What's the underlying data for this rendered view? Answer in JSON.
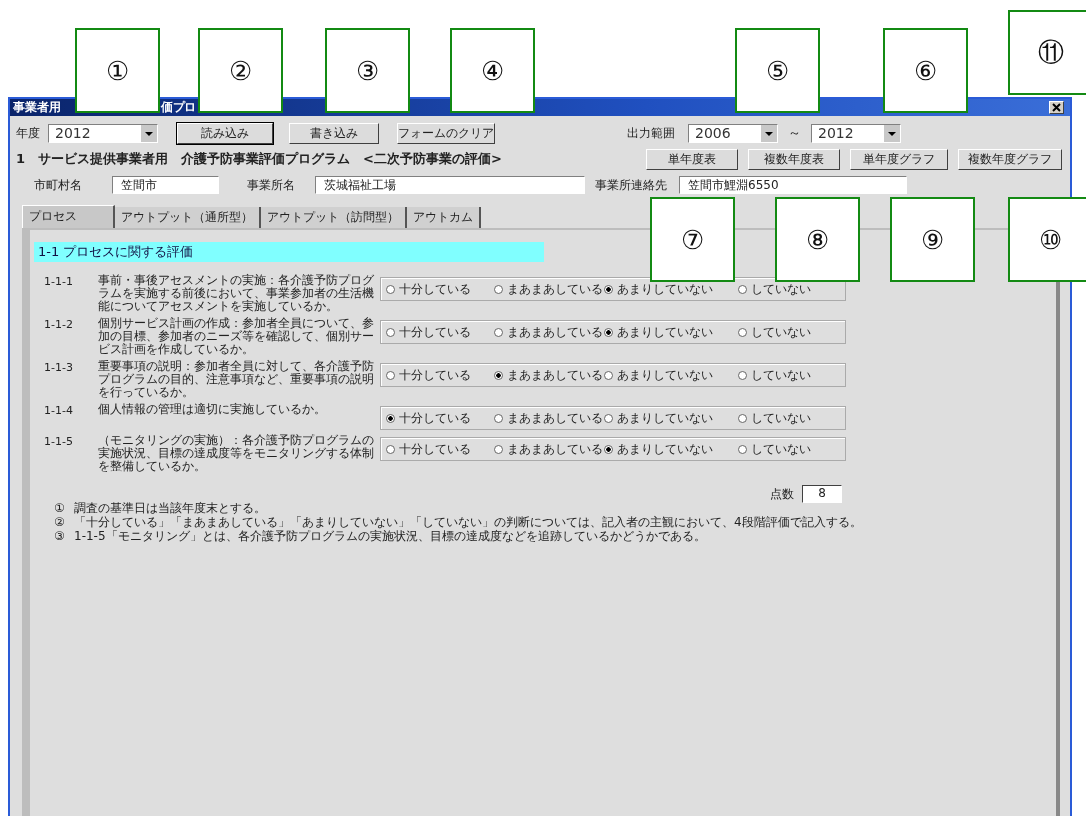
{
  "callouts": [
    {
      "label": "①"
    },
    {
      "label": "②"
    },
    {
      "label": "③"
    },
    {
      "label": "④"
    },
    {
      "label": "⑤"
    },
    {
      "label": "⑥"
    },
    {
      "label": "⑪"
    },
    {
      "label": "⑦"
    },
    {
      "label": "⑧"
    },
    {
      "label": "⑨"
    },
    {
      "label": "⑩"
    }
  ],
  "window": {
    "title_parts": [
      "事業者用",
      "価プロ"
    ]
  },
  "toolbar": {
    "year_label": "年度",
    "year": "2012",
    "buttons": [
      {
        "label": "読み込み",
        "default": true
      },
      {
        "label": "書き込み",
        "default": false
      },
      {
        "label": "フォームのクリア",
        "default": false
      }
    ],
    "range_label": "出力範囲",
    "range_from": "2006",
    "range_sep": "～",
    "range_to": "2012"
  },
  "heading": "1　サービス提供事業者用　介護予防事業評価プログラム　<二次予防事業の評価>",
  "report_buttons": [
    "単年度表",
    "複数年度表",
    "単年度グラフ",
    "複数年度グラフ"
  ],
  "fields": [
    {
      "label": "市町村名",
      "value": "笠間市"
    },
    {
      "label": "事業所名",
      "value": "茨城福祉工場"
    },
    {
      "label": "事業所連絡先",
      "value": "笠間市鯉淵6550"
    }
  ],
  "tabs": [
    {
      "label": "プロセス",
      "selected": true
    },
    {
      "label": "アウトプット（通所型）",
      "selected": false
    },
    {
      "label": "アウトプット（訪問型）",
      "selected": false
    },
    {
      "label": "アウトカム",
      "selected": false
    }
  ],
  "section": "1-1 プロセスに関する評価",
  "items": [
    {
      "number": "1-1-1",
      "text": "事前・事後アセスメントの実施：各介護予防プログラムを実施する前後において、事業参加者の生活機能についてアセスメントを実施しているか。",
      "options": [
        {
          "label": "十分している",
          "selected": false
        },
        {
          "label": "まあまあしている",
          "selected": false
        },
        {
          "label": "あまりしていない",
          "selected": true
        },
        {
          "label": "していない",
          "selected": false
        }
      ]
    },
    {
      "number": "1-1-2",
      "text": "個別サービス計画の作成：参加者全員について、参加の目標、参加者のニーズ等を確認して、個別サービス計画を作成しているか。",
      "options": [
        {
          "label": "十分している",
          "selected": false
        },
        {
          "label": "まあまあしている",
          "selected": false
        },
        {
          "label": "あまりしていない",
          "selected": true
        },
        {
          "label": "していない",
          "selected": false
        }
      ]
    },
    {
      "number": "1-1-3",
      "text": "重要事項の説明：参加者全員に対して、各介護予防プログラムの目的、注意事項など、重要事項の説明を行っているか。",
      "options": [
        {
          "label": "十分している",
          "selected": false
        },
        {
          "label": "まあまあしている",
          "selected": true
        },
        {
          "label": "あまりしていない",
          "selected": false
        },
        {
          "label": "していない",
          "selected": false
        }
      ]
    },
    {
      "number": "1-1-4",
      "text": "個人情報の管理は適切に実施しているか。",
      "options": [
        {
          "label": "十分している",
          "selected": true
        },
        {
          "label": "まあまあしている",
          "selected": false
        },
        {
          "label": "あまりしていない",
          "selected": false
        },
        {
          "label": "していない",
          "selected": false
        }
      ]
    },
    {
      "number": "1-1-5",
      "text": "（モニタリングの実施）：各介護予防プログラムの実施状況、目標の達成度等をモニタリングする体制を整備しているか。",
      "options": [
        {
          "label": "十分している",
          "selected": false
        },
        {
          "label": "まあまあしている",
          "selected": false
        },
        {
          "label": "あまりしていない",
          "selected": true
        },
        {
          "label": "していない",
          "selected": false
        }
      ]
    }
  ],
  "score": {
    "label": "点数",
    "value": "8"
  },
  "notes": [
    {
      "mark": "①",
      "text": "調査の基準日は当該年度末とする。"
    },
    {
      "mark": "②",
      "text": "「十分している」「まあまあしている」「あまりしていない」「していない」の判断については、記入者の主観において、4段階評価で記入する。"
    },
    {
      "mark": "③",
      "text": "1-1-5「モニタリング」とは、各介護予防プログラムの実施状況、目標の達成度などを追跡しているかどうかである。"
    }
  ]
}
